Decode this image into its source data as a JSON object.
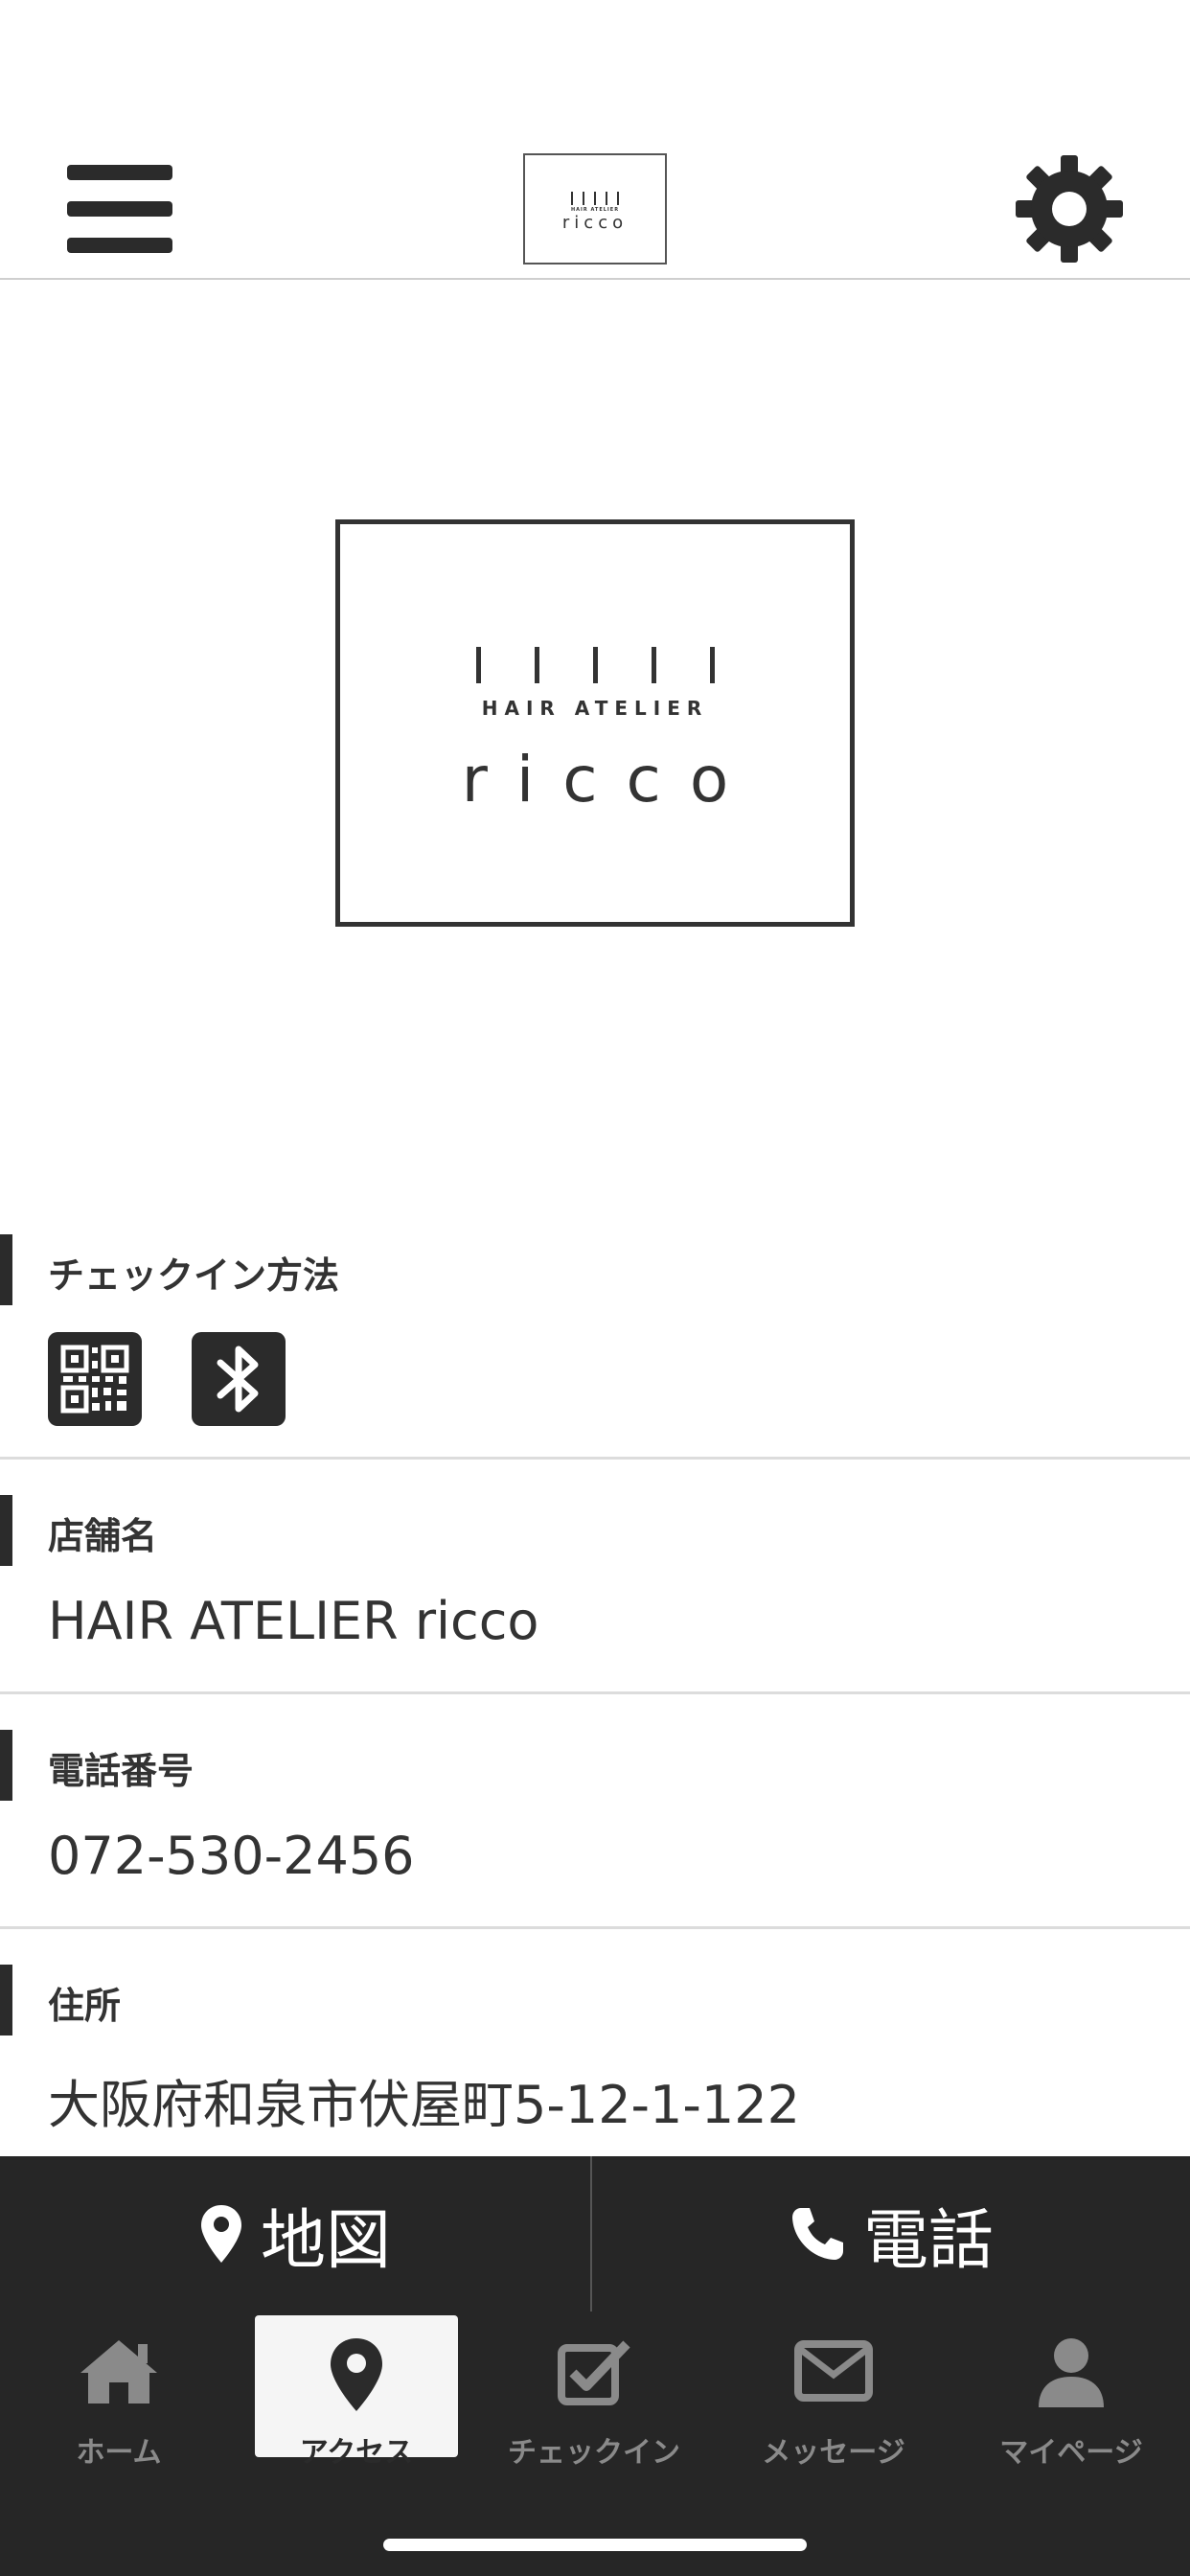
{
  "header": {
    "menu_icon": "hamburger-menu-icon",
    "settings_icon": "gear-icon",
    "logo_sub": "HAIR ATELIER",
    "logo_main": "ricco"
  },
  "hero": {
    "logo_sub": "HAIR ATELIER",
    "logo_main": "ricco"
  },
  "sections": {
    "checkin": {
      "label": "チェックイン方法",
      "icons": [
        "qr-code-icon",
        "bluetooth-icon"
      ]
    },
    "store": {
      "label": "店舗名",
      "value": "HAIR ATELIER ricco"
    },
    "phone": {
      "label": "電話番号",
      "value": "072-530-2456"
    },
    "address": {
      "label": "住所",
      "value": "大阪府和泉市伏屋町5-12-1-122"
    }
  },
  "actions": {
    "map_label": "地図",
    "call_label": "電話"
  },
  "tabs": [
    {
      "label": "ホーム",
      "icon": "home-icon",
      "active": false
    },
    {
      "label": "アクセス",
      "icon": "location-pin-icon",
      "active": true
    },
    {
      "label": "チェックイン",
      "icon": "checkbox-icon",
      "active": false
    },
    {
      "label": "メッセージ",
      "icon": "envelope-icon",
      "active": false
    },
    {
      "label": "マイページ",
      "icon": "user-icon",
      "active": false
    }
  ],
  "colors": {
    "dark": "#262626",
    "text": "#333333",
    "tab_inactive": "#8a8a8a",
    "tab_active_bg": "#f5f5f5"
  }
}
